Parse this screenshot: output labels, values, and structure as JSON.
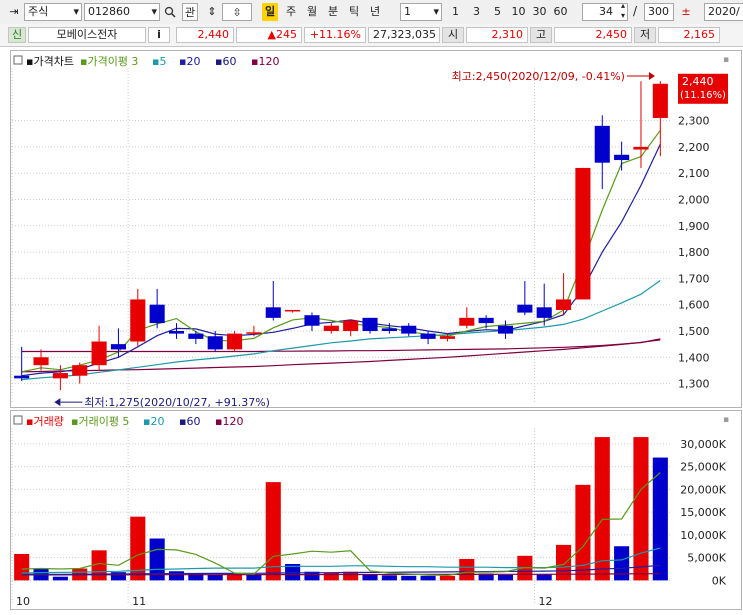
{
  "toolbar": {
    "market": "주식",
    "code": "012860",
    "search_glyph": "🔍",
    "watch_label": "관",
    "periods": [
      "일",
      "주",
      "월",
      "분",
      "틱",
      "년"
    ],
    "active_period": "일",
    "interval_value": "1",
    "interval_buttons": [
      "1",
      "3",
      "5",
      "10",
      "30",
      "60"
    ],
    "count": "34",
    "slash": "/",
    "total": "300",
    "date": "2020/"
  },
  "quote": {
    "badge": "신",
    "name": "모베이스전자",
    "info": "i",
    "price": "2,440",
    "change": "▲245",
    "change_pct": "+11.16%",
    "volume": "27,323,035",
    "open_label": "시",
    "open": "2,310",
    "high_label": "고",
    "high": "2,450",
    "low_label": "저",
    "low": "2,165"
  },
  "colors": {
    "up": "#e60000",
    "down": "#0000cc",
    "ma3": "#5a9a1a",
    "ma5": "#1a9aaa",
    "ma20": "#2020a0",
    "ma60": "#800040",
    "ma120": "#800040",
    "grid": "#cccccc"
  },
  "price_legend": [
    {
      "text": "가격차트",
      "color": "#111111"
    },
    {
      "text": "가격이평 3",
      "color": "#5a9a1a"
    },
    {
      "text": "5",
      "color": "#1a9aaa"
    },
    {
      "text": "20",
      "color": "#2020a0"
    },
    {
      "text": "60",
      "color": "#1a1a80"
    },
    {
      "text": "120",
      "color": "#800040"
    }
  ],
  "volume_legend": [
    {
      "text": "거래량",
      "color": "#e60000"
    },
    {
      "text": "거래이평 5",
      "color": "#5a9a1a"
    },
    {
      "text": "20",
      "color": "#1a9aaa"
    },
    {
      "text": "60",
      "color": "#1a1a80"
    },
    {
      "text": "120",
      "color": "#800040"
    }
  ],
  "annotations": {
    "high": "최고:2,450(2020/12/09, -0.41%)",
    "low": "최저:1,275(2020/10/27, +91.37%)"
  },
  "current_price": {
    "line1": "2,440",
    "line2": "(11.16%)"
  },
  "chart_data": [
    {
      "type": "candlestick",
      "title": "가격차트",
      "ylim": [
        1230,
        2500
      ],
      "yticks": [
        1300,
        1400,
        1500,
        1600,
        1700,
        1800,
        1900,
        2000,
        2100,
        2200,
        2300
      ],
      "ytick_labels": [
        "1,300",
        "1,400",
        "1,500",
        "1,600",
        "1,700",
        "1,800",
        "1,900",
        "2,000",
        "2,100",
        "2,200",
        "2,300"
      ],
      "x_labels": [
        {
          "index": 0,
          "text": "10"
        },
        {
          "index": 6,
          "text": "11"
        },
        {
          "index": 27,
          "text": "12"
        }
      ],
      "ohlc": [
        [
          1330,
          1440,
          1310,
          1320
        ],
        [
          1370,
          1430,
          1350,
          1400
        ],
        [
          1320,
          1370,
          1275,
          1340
        ],
        [
          1330,
          1380,
          1300,
          1370
        ],
        [
          1370,
          1520,
          1350,
          1460
        ],
        [
          1450,
          1510,
          1400,
          1430
        ],
        [
          1460,
          1660,
          1440,
          1620
        ],
        [
          1600,
          1660,
          1510,
          1530
        ],
        [
          1500,
          1530,
          1470,
          1490
        ],
        [
          1490,
          1500,
          1450,
          1470
        ],
        [
          1480,
          1500,
          1420,
          1430
        ],
        [
          1430,
          1500,
          1420,
          1490
        ],
        [
          1490,
          1520,
          1480,
          1495
        ],
        [
          1590,
          1690,
          1540,
          1550
        ],
        [
          1580,
          1580,
          1570,
          1580
        ],
        [
          1560,
          1570,
          1500,
          1520
        ],
        [
          1500,
          1530,
          1490,
          1520
        ],
        [
          1500,
          1540,
          1480,
          1540
        ],
        [
          1550,
          1550,
          1490,
          1500
        ],
        [
          1510,
          1530,
          1490,
          1500
        ],
        [
          1520,
          1530,
          1480,
          1490
        ],
        [
          1490,
          1500,
          1450,
          1470
        ],
        [
          1470,
          1490,
          1460,
          1480
        ],
        [
          1520,
          1590,
          1510,
          1550
        ],
        [
          1550,
          1560,
          1510,
          1530
        ],
        [
          1520,
          1540,
          1470,
          1490
        ],
        [
          1600,
          1690,
          1560,
          1570
        ],
        [
          1590,
          1680,
          1520,
          1550
        ],
        [
          1580,
          1720,
          1560,
          1620
        ],
        [
          1620,
          2120,
          1620,
          2120
        ],
        [
          2280,
          2320,
          2040,
          2140
        ],
        [
          2170,
          2220,
          2110,
          2150
        ],
        [
          2190,
          2450,
          2120,
          2200
        ],
        [
          2310,
          2450,
          2165,
          2440
        ]
      ],
      "ma3": [
        1345,
        1360,
        1353,
        1370,
        1390,
        1420,
        1503,
        1527,
        1547,
        1497,
        1463,
        1463,
        1472,
        1512,
        1542,
        1550,
        1540,
        1527,
        1520,
        1513,
        1497,
        1487,
        1480,
        1500,
        1517,
        1523,
        1530,
        1537,
        1580,
        1763,
        1960,
        2137,
        2163,
        2263
      ],
      "ma5": [
        1330,
        1340,
        1345,
        1355,
        1378,
        1400,
        1440,
        1482,
        1510,
        1508,
        1488,
        1482,
        1487,
        1495,
        1510,
        1527,
        1533,
        1542,
        1530,
        1520,
        1512,
        1500,
        1490,
        1498,
        1505,
        1502,
        1520,
        1537,
        1562,
        1660,
        1800,
        1915,
        2054,
        2210
      ],
      "ma20": [
        1315,
        1322,
        1327,
        1333,
        1343,
        1352,
        1362,
        1372,
        1382,
        1390,
        1397,
        1405,
        1413,
        1425,
        1435,
        1445,
        1455,
        1462,
        1470,
        1474,
        1478,
        1482,
        1486,
        1492,
        1497,
        1502,
        1508,
        1515,
        1525,
        1545,
        1576,
        1607,
        1640,
        1692
      ],
      "ma60": [
        1345,
        1346,
        1348,
        1349,
        1350,
        1352,
        1353,
        1355,
        1357,
        1359,
        1361,
        1363,
        1365,
        1368,
        1372,
        1375,
        1378,
        1381,
        1384,
        1388,
        1392,
        1396,
        1400,
        1405,
        1410,
        1415,
        1420,
        1425,
        1430,
        1436,
        1442,
        1449,
        1457,
        1466
      ],
      "ma120": [
        1422,
        1422,
        1422,
        1422,
        1422,
        1422,
        1422,
        1422,
        1422,
        1422,
        1422,
        1422,
        1422,
        1423,
        1423,
        1424,
        1424,
        1425,
        1425,
        1426,
        1427,
        1428,
        1429,
        1430,
        1431,
        1432,
        1434,
        1436,
        1438,
        1441,
        1445,
        1450,
        1456,
        1470
      ]
    },
    {
      "type": "bar",
      "title": "거래량",
      "ylim": [
        -3000,
        33500
      ],
      "yticks": [
        0,
        5000,
        10000,
        15000,
        20000,
        25000,
        30000
      ],
      "ytick_labels": [
        "0K",
        "5,000K",
        "10,000K",
        "15,000K",
        "20,000K",
        "25,000K",
        "30,000K"
      ],
      "values": [
        5800,
        2600,
        800,
        2600,
        6600,
        1800,
        14000,
        9200,
        2000,
        1600,
        1200,
        1200,
        1200,
        21600,
        3600,
        1900,
        1700,
        1900,
        1200,
        1100,
        1000,
        1000,
        1000,
        4700,
        1500,
        1200,
        5400,
        1400,
        7800,
        21000,
        31500,
        7500,
        31500,
        27000
      ],
      "up": [
        true,
        false,
        false,
        true,
        true,
        false,
        true,
        false,
        false,
        false,
        false,
        true,
        false,
        true,
        false,
        false,
        true,
        true,
        false,
        false,
        false,
        false,
        true,
        true,
        false,
        false,
        true,
        false,
        true,
        true,
        true,
        false,
        true,
        false
      ],
      "ma5": [
        2500,
        2600,
        2500,
        2600,
        3700,
        3300,
        5600,
        6800,
        6700,
        5700,
        3800,
        1600,
        1400,
        5300,
        5800,
        6400,
        6200,
        6500,
        2100,
        1600,
        1400,
        1200,
        1100,
        1800,
        1800,
        1900,
        2800,
        2700,
        3500,
        7400,
        13400,
        13500,
        20000,
        23700
      ],
      "ma20": [
        1600,
        1700,
        1750,
        1800,
        1900,
        2000,
        2200,
        2400,
        2500,
        2600,
        2700,
        2700,
        2700,
        3000,
        3100,
        3100,
        3100,
        3200,
        3200,
        3100,
        3000,
        3000,
        2900,
        2900,
        2900,
        2800,
        2800,
        2800,
        2900,
        3300,
        4300,
        4500,
        6000,
        7100
      ],
      "ma60": [
        1300,
        1320,
        1340,
        1360,
        1380,
        1400,
        1430,
        1460,
        1480,
        1500,
        1520,
        1540,
        1560,
        1600,
        1630,
        1660,
        1690,
        1720,
        1750,
        1780,
        1810,
        1840,
        1870,
        1900,
        1930,
        1960,
        2000,
        2040,
        2100,
        2250,
        2500,
        2650,
        2950,
        3300
      ],
      "ma120": [
        1200,
        1205,
        1210,
        1215,
        1220,
        1225,
        1230,
        1235,
        1240,
        1245,
        1250,
        1255,
        1260,
        1265,
        1270,
        1275,
        1280,
        1285,
        1290,
        1295,
        1300,
        1305,
        1310,
        1315,
        1320,
        1325,
        1330,
        1335,
        1345,
        1360,
        1390,
        1410,
        1440,
        1470
      ]
    }
  ]
}
